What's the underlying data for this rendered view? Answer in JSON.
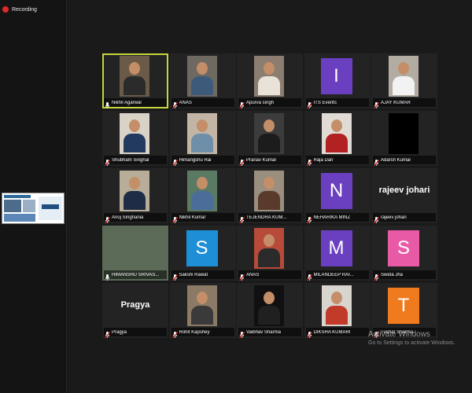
{
  "recording": {
    "label": "Recording",
    "color": "#e02828"
  },
  "colors": {
    "active_speaker": "#c7d63b",
    "tile_bg": "#232323",
    "app_bg": "#1a1a1a"
  },
  "participants": [
    {
      "name": "Nikhil Agarwal",
      "kind": "photo",
      "active": true,
      "muted": false,
      "bg": "#6b5a48",
      "shirt": "#2b2b2b"
    },
    {
      "name": "ANAS",
      "kind": "photo",
      "muted": true,
      "bg": "#6e6a62",
      "shirt": "#3d5a7a"
    },
    {
      "name": "Apurva singh",
      "kind": "photo",
      "muted": true,
      "bg": "#8b7d70",
      "shirt": "#e8e2d8"
    },
    {
      "name": "ITS Events",
      "kind": "letter",
      "letter": "I",
      "color": "#6a3fc0",
      "muted": true
    },
    {
      "name": "AJAY KUMAR",
      "kind": "photo",
      "muted": true,
      "bg": "#b3aca3",
      "shirt": "#f2f2f2"
    },
    {
      "name": "Shubham Singhal",
      "kind": "photo",
      "muted": true,
      "bg": "#d9d3c7",
      "shirt": "#223a5e"
    },
    {
      "name": "Himangshu Rai",
      "kind": "photo",
      "muted": true,
      "bg": "#c2b5a5",
      "shirt": "#6f8fa8"
    },
    {
      "name": "Pranav Kumar",
      "kind": "photo",
      "muted": true,
      "bg": "#3c3c3c",
      "shirt": "#1c1c1c"
    },
    {
      "name": "Raja Dari",
      "kind": "photo",
      "muted": true,
      "bg": "#e0dcd5",
      "shirt": "#b22222"
    },
    {
      "name": "Adarsh Kumar",
      "kind": "blank",
      "muted": true
    },
    {
      "name": "Anuj Singhania",
      "kind": "photo",
      "muted": true,
      "bg": "#b8ad98",
      "shirt": "#1e2c45"
    },
    {
      "name": "Nikhil Kumar",
      "kind": "photo",
      "muted": true,
      "bg": "#5b7a63",
      "shirt": "#4a6d9a"
    },
    {
      "name": "TEJENDRA KUM...",
      "kind": "photo",
      "muted": true,
      "bg": "#9a8e7e",
      "shirt": "#5a3a2a"
    },
    {
      "name": "NEHARIKA MINZ",
      "kind": "letter",
      "letter": "N",
      "color": "#6a3fc0",
      "muted": true
    },
    {
      "name": "rajeev johari",
      "kind": "name",
      "muted": true
    },
    {
      "name": "HIMANSHU SRIVAS...",
      "kind": "photo",
      "muted": false,
      "bg": "#5b6b58",
      "shirt": "#5b6b58",
      "nohead": true
    },
    {
      "name": "Sakshi Rawat",
      "kind": "letter",
      "letter": "S",
      "color": "#1e8fd6",
      "muted": true
    },
    {
      "name": "ANAS",
      "kind": "photo",
      "muted": true,
      "bg": "#b84a3a",
      "shirt": "#2b2b2b"
    },
    {
      "name": "MILANDEEP RAI...",
      "kind": "letter",
      "letter": "M",
      "color": "#6a3fc0",
      "muted": true
    },
    {
      "name": "Sweta Jha",
      "kind": "letter",
      "letter": "S",
      "color": "#e85aa6",
      "muted": true
    },
    {
      "name": "Pragya",
      "kind": "name",
      "muted": true
    },
    {
      "name": "Rohit Kapshey",
      "kind": "photo",
      "muted": true,
      "bg": "#8a7a66",
      "shirt": "#3a3a3a"
    },
    {
      "name": "Vaibhav Sharma",
      "kind": "photo",
      "muted": true,
      "bg": "#101010",
      "shirt": "#202020"
    },
    {
      "name": "DIKSHA KUMARI",
      "kind": "photo",
      "muted": true,
      "bg": "#d8d4ce",
      "shirt": "#c23a2a"
    },
    {
      "name": "Tushar Sharma",
      "kind": "letter",
      "letter": "T",
      "color": "#f07a1e",
      "muted": true
    }
  ],
  "activate": {
    "title": "Activate Windows",
    "subtitle": "Go to Settings to activate Windows."
  }
}
